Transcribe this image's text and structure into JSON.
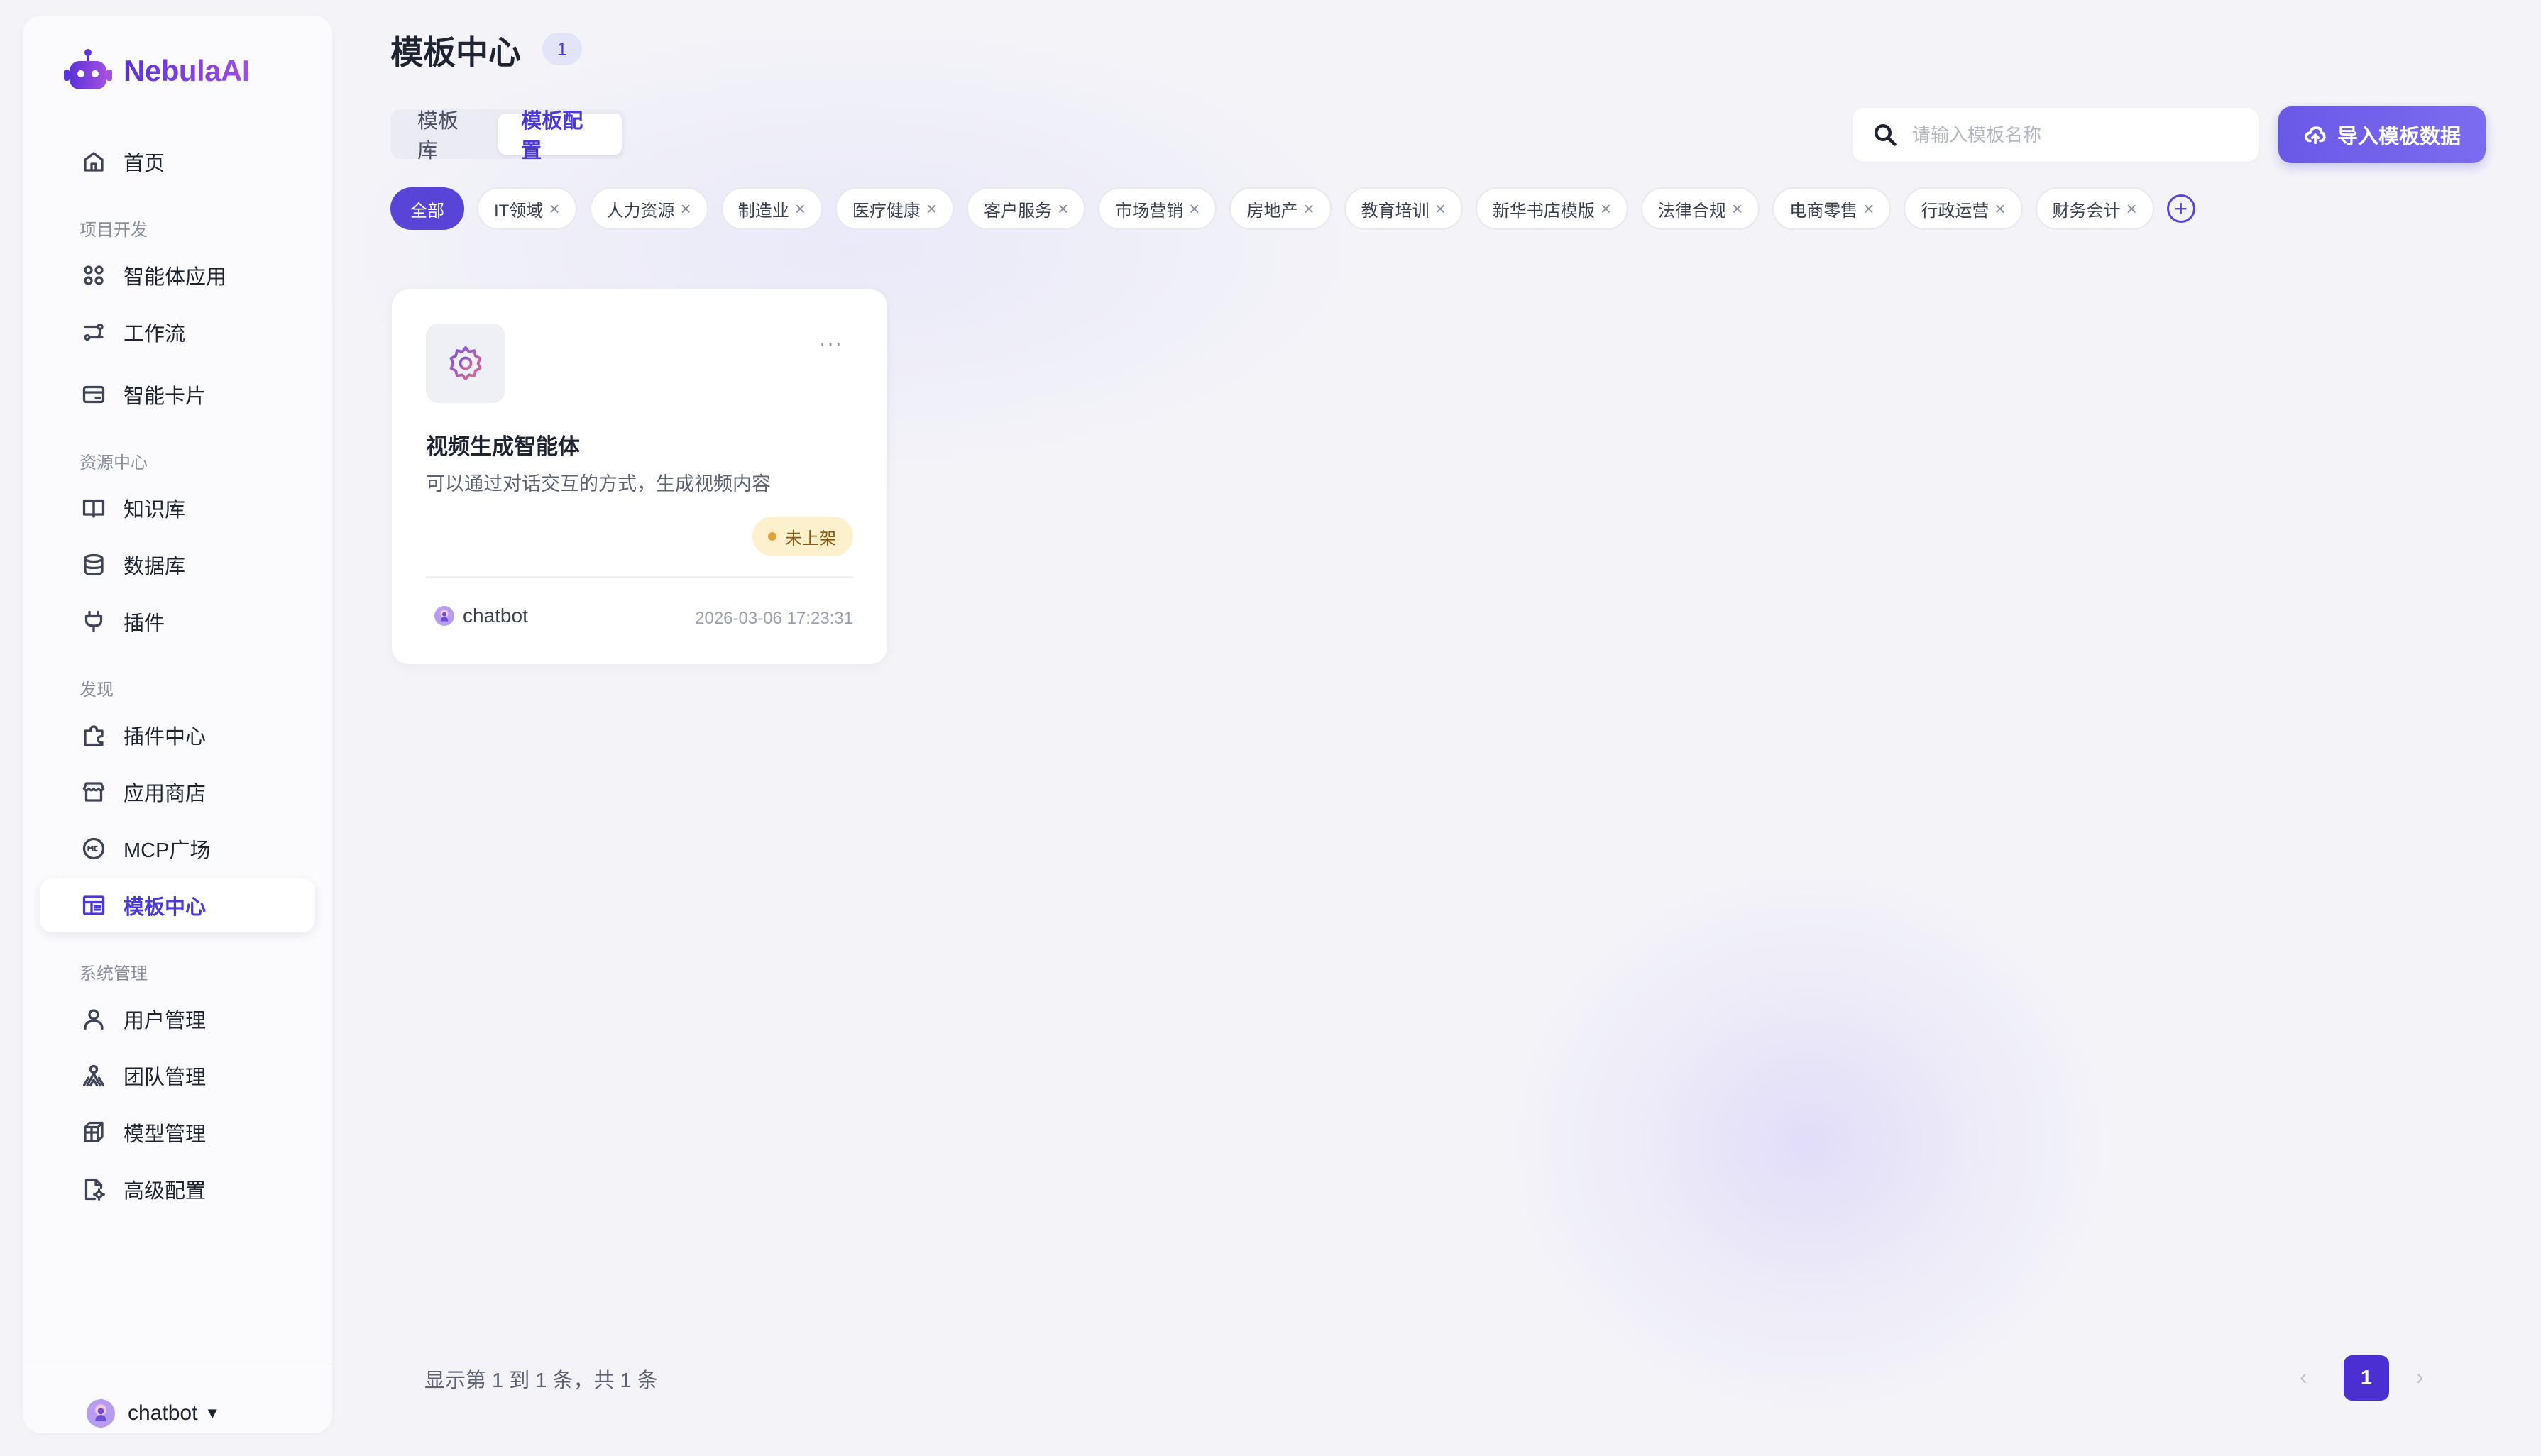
{
  "app": {
    "name": "NebulaAI"
  },
  "sidebar": {
    "items": [
      {
        "label": "首页",
        "icon": "home-icon"
      },
      {
        "label": "智能体应用",
        "icon": "apps-grid-icon"
      },
      {
        "label": "工作流",
        "icon": "workflow-icon"
      },
      {
        "label": "智能卡片",
        "icon": "card-icon"
      },
      {
        "label": "知识库",
        "icon": "book-icon"
      },
      {
        "label": "数据库",
        "icon": "database-icon"
      },
      {
        "label": "插件",
        "icon": "plug-icon"
      },
      {
        "label": "插件中心",
        "icon": "puzzle-icon"
      },
      {
        "label": "应用商店",
        "icon": "store-icon"
      },
      {
        "label": "MCP广场",
        "icon": "mcp-icon"
      },
      {
        "label": "模板中心",
        "icon": "template-icon",
        "active": true
      },
      {
        "label": "用户管理",
        "icon": "user-icon"
      },
      {
        "label": "团队管理",
        "icon": "team-icon"
      },
      {
        "label": "模型管理",
        "icon": "cube-icon"
      },
      {
        "label": "高级配置",
        "icon": "settings-file-icon"
      }
    ],
    "sections": [
      "项目开发",
      "资源中心",
      "发现",
      "系统管理"
    ]
  },
  "user": {
    "name": "chatbot"
  },
  "header": {
    "title": "模板中心",
    "count": "1"
  },
  "tabs": [
    {
      "label": "模板库"
    },
    {
      "label": "模板配置",
      "active": true
    }
  ],
  "search": {
    "placeholder": "请输入模板名称",
    "value": ""
  },
  "import_button": {
    "label": "导入模板数据"
  },
  "tags": [
    {
      "label": "全部",
      "active": true
    },
    {
      "label": "IT领域"
    },
    {
      "label": "人力资源"
    },
    {
      "label": "制造业"
    },
    {
      "label": "医疗健康"
    },
    {
      "label": "客户服务"
    },
    {
      "label": "市场营销"
    },
    {
      "label": "房地产"
    },
    {
      "label": "教育培训"
    },
    {
      "label": "新华书店模版"
    },
    {
      "label": "法律合规"
    },
    {
      "label": "电商零售"
    },
    {
      "label": "行政运营"
    },
    {
      "label": "财务会计"
    }
  ],
  "cards": [
    {
      "title": "视频生成智能体",
      "description": "可以通过对话交互的方式，生成视频内容",
      "status": "未上架",
      "owner": "chatbot",
      "time": "2026-03-06 17:23:31",
      "more": "···"
    }
  ],
  "pagination": {
    "info": "显示第 1 到 1 条，共 1 条",
    "current": "1",
    "prev": "‹",
    "next": "›"
  },
  "colors": {
    "accent": "#4b3ad6",
    "accent_button": "#6a59e6",
    "status_bg": "#fdf0cc",
    "background": "#f4f4f8"
  }
}
